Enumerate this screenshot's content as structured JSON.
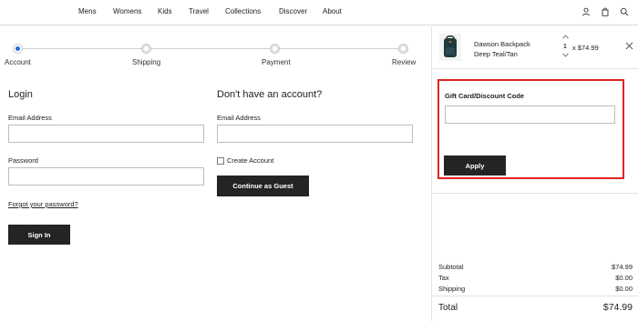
{
  "nav": {
    "items": [
      "Mens",
      "Womens",
      "Kids",
      "Travel",
      "Collections",
      "Discover",
      "About"
    ],
    "icons": [
      "user-icon",
      "bag-icon",
      "search-icon"
    ]
  },
  "steps": {
    "items": [
      "Account",
      "Shipping",
      "Payment",
      "Review"
    ],
    "active_index": 0,
    "active_color": "#1f6fe0"
  },
  "login": {
    "title": "Login",
    "email_label": "Email Address",
    "email_value": "",
    "password_label": "Password",
    "password_value": "",
    "forgot_link": "Forgot your password?",
    "sign_in_button": "Sign In"
  },
  "guest": {
    "title": "Don't have an account?",
    "email_label": "Email Address",
    "email_value": "",
    "create_account_label": "Create Account",
    "create_account_checked": false,
    "continue_button": "Continue as Guest"
  },
  "cart": {
    "product_name_line1": "Dawson Backpack",
    "product_name_line2": "Deep Teal/Tan",
    "quantity": "1",
    "price_text": "x $74.99"
  },
  "gift": {
    "label": "Gift Card/Discount Code",
    "input_value": "",
    "apply_button": "Apply",
    "highlight_color": "#e32222"
  },
  "summary": {
    "subtotal_label": "Subtotal",
    "subtotal_value": "$74.99",
    "tax_label": "Tax",
    "tax_value": "$0.00",
    "shipping_label": "Shipping",
    "shipping_value": "$0.00",
    "total_label": "Total",
    "total_value": "$74.99"
  }
}
